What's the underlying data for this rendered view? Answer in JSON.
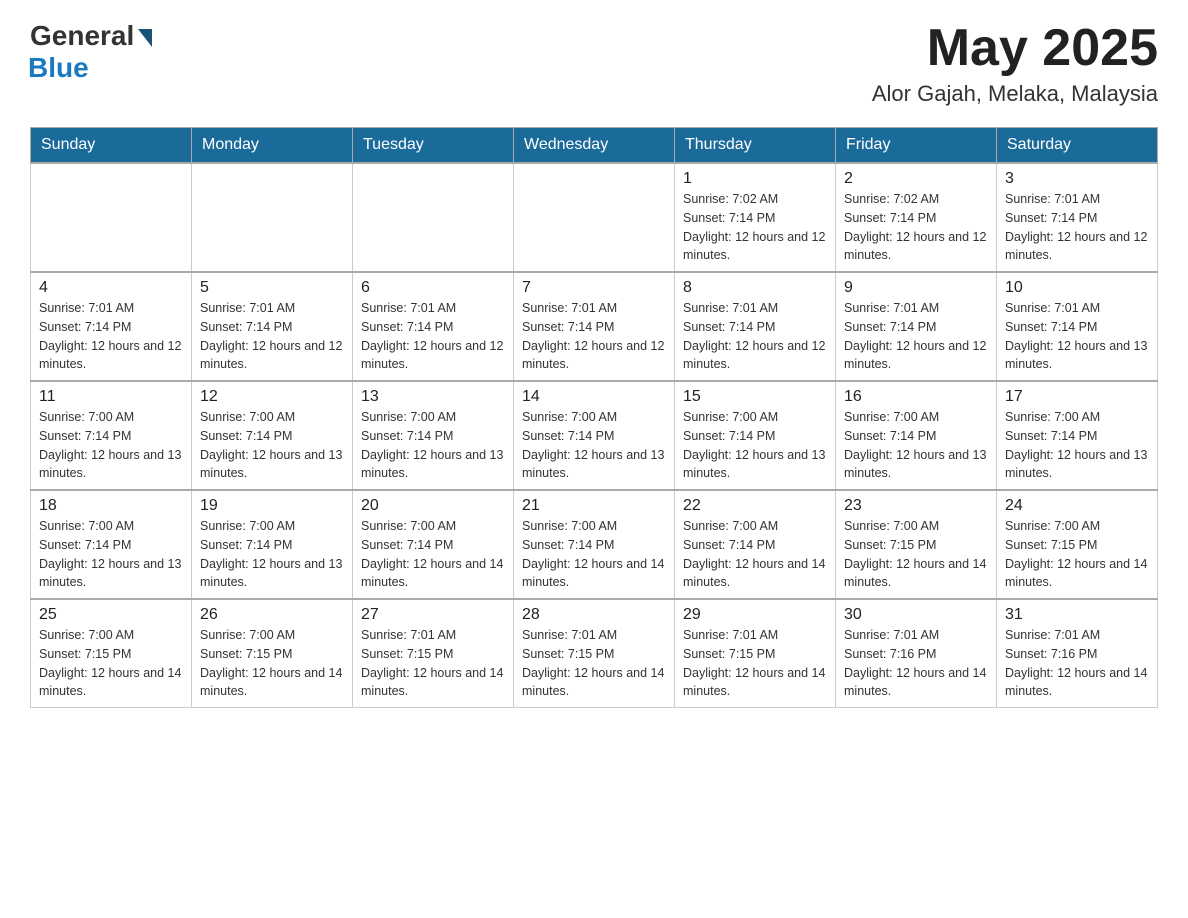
{
  "header": {
    "logo_general": "General",
    "logo_blue": "Blue",
    "month_title": "May 2025",
    "location": "Alor Gajah, Melaka, Malaysia"
  },
  "weekdays": [
    "Sunday",
    "Monday",
    "Tuesday",
    "Wednesday",
    "Thursday",
    "Friday",
    "Saturday"
  ],
  "weeks": [
    [
      {
        "day": "",
        "info": ""
      },
      {
        "day": "",
        "info": ""
      },
      {
        "day": "",
        "info": ""
      },
      {
        "day": "",
        "info": ""
      },
      {
        "day": "1",
        "info": "Sunrise: 7:02 AM\nSunset: 7:14 PM\nDaylight: 12 hours and 12 minutes."
      },
      {
        "day": "2",
        "info": "Sunrise: 7:02 AM\nSunset: 7:14 PM\nDaylight: 12 hours and 12 minutes."
      },
      {
        "day": "3",
        "info": "Sunrise: 7:01 AM\nSunset: 7:14 PM\nDaylight: 12 hours and 12 minutes."
      }
    ],
    [
      {
        "day": "4",
        "info": "Sunrise: 7:01 AM\nSunset: 7:14 PM\nDaylight: 12 hours and 12 minutes."
      },
      {
        "day": "5",
        "info": "Sunrise: 7:01 AM\nSunset: 7:14 PM\nDaylight: 12 hours and 12 minutes."
      },
      {
        "day": "6",
        "info": "Sunrise: 7:01 AM\nSunset: 7:14 PM\nDaylight: 12 hours and 12 minutes."
      },
      {
        "day": "7",
        "info": "Sunrise: 7:01 AM\nSunset: 7:14 PM\nDaylight: 12 hours and 12 minutes."
      },
      {
        "day": "8",
        "info": "Sunrise: 7:01 AM\nSunset: 7:14 PM\nDaylight: 12 hours and 12 minutes."
      },
      {
        "day": "9",
        "info": "Sunrise: 7:01 AM\nSunset: 7:14 PM\nDaylight: 12 hours and 12 minutes."
      },
      {
        "day": "10",
        "info": "Sunrise: 7:01 AM\nSunset: 7:14 PM\nDaylight: 12 hours and 13 minutes."
      }
    ],
    [
      {
        "day": "11",
        "info": "Sunrise: 7:00 AM\nSunset: 7:14 PM\nDaylight: 12 hours and 13 minutes."
      },
      {
        "day": "12",
        "info": "Sunrise: 7:00 AM\nSunset: 7:14 PM\nDaylight: 12 hours and 13 minutes."
      },
      {
        "day": "13",
        "info": "Sunrise: 7:00 AM\nSunset: 7:14 PM\nDaylight: 12 hours and 13 minutes."
      },
      {
        "day": "14",
        "info": "Sunrise: 7:00 AM\nSunset: 7:14 PM\nDaylight: 12 hours and 13 minutes."
      },
      {
        "day": "15",
        "info": "Sunrise: 7:00 AM\nSunset: 7:14 PM\nDaylight: 12 hours and 13 minutes."
      },
      {
        "day": "16",
        "info": "Sunrise: 7:00 AM\nSunset: 7:14 PM\nDaylight: 12 hours and 13 minutes."
      },
      {
        "day": "17",
        "info": "Sunrise: 7:00 AM\nSunset: 7:14 PM\nDaylight: 12 hours and 13 minutes."
      }
    ],
    [
      {
        "day": "18",
        "info": "Sunrise: 7:00 AM\nSunset: 7:14 PM\nDaylight: 12 hours and 13 minutes."
      },
      {
        "day": "19",
        "info": "Sunrise: 7:00 AM\nSunset: 7:14 PM\nDaylight: 12 hours and 13 minutes."
      },
      {
        "day": "20",
        "info": "Sunrise: 7:00 AM\nSunset: 7:14 PM\nDaylight: 12 hours and 14 minutes."
      },
      {
        "day": "21",
        "info": "Sunrise: 7:00 AM\nSunset: 7:14 PM\nDaylight: 12 hours and 14 minutes."
      },
      {
        "day": "22",
        "info": "Sunrise: 7:00 AM\nSunset: 7:14 PM\nDaylight: 12 hours and 14 minutes."
      },
      {
        "day": "23",
        "info": "Sunrise: 7:00 AM\nSunset: 7:15 PM\nDaylight: 12 hours and 14 minutes."
      },
      {
        "day": "24",
        "info": "Sunrise: 7:00 AM\nSunset: 7:15 PM\nDaylight: 12 hours and 14 minutes."
      }
    ],
    [
      {
        "day": "25",
        "info": "Sunrise: 7:00 AM\nSunset: 7:15 PM\nDaylight: 12 hours and 14 minutes."
      },
      {
        "day": "26",
        "info": "Sunrise: 7:00 AM\nSunset: 7:15 PM\nDaylight: 12 hours and 14 minutes."
      },
      {
        "day": "27",
        "info": "Sunrise: 7:01 AM\nSunset: 7:15 PM\nDaylight: 12 hours and 14 minutes."
      },
      {
        "day": "28",
        "info": "Sunrise: 7:01 AM\nSunset: 7:15 PM\nDaylight: 12 hours and 14 minutes."
      },
      {
        "day": "29",
        "info": "Sunrise: 7:01 AM\nSunset: 7:15 PM\nDaylight: 12 hours and 14 minutes."
      },
      {
        "day": "30",
        "info": "Sunrise: 7:01 AM\nSunset: 7:16 PM\nDaylight: 12 hours and 14 minutes."
      },
      {
        "day": "31",
        "info": "Sunrise: 7:01 AM\nSunset: 7:16 PM\nDaylight: 12 hours and 14 minutes."
      }
    ]
  ]
}
